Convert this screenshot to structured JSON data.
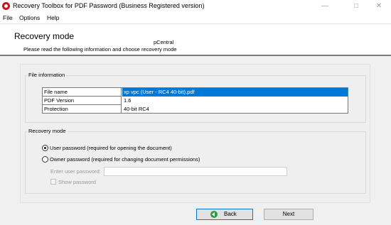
{
  "window": {
    "title": "Recovery Toolbox for PDF Password (Business Registered version)",
    "minimize_glyph": "—",
    "maximize_glyph": "□",
    "close_glyph": "✕"
  },
  "menu": {
    "items": [
      "File",
      "Options",
      "Help"
    ]
  },
  "header": {
    "title": "Recovery mode",
    "brand": "pCentral",
    "subtitle": "Please read the following information and choose recovery mode"
  },
  "file_information": {
    "group_title": "File information",
    "rows": [
      {
        "key": "File name",
        "value": "xp vpc (User - RC4 40-bit).pdf"
      },
      {
        "key": "PDF Version",
        "value": "1.6"
      },
      {
        "key": "Protection",
        "value": "40-bit RC4"
      }
    ]
  },
  "recovery_mode": {
    "group_title": "Recovery mode",
    "options": [
      {
        "label": "User password (required for opening the document)",
        "checked": true
      },
      {
        "label": "Owner password (required for changing document permissions)",
        "checked": false
      }
    ],
    "password_label": "Enter user password:",
    "password_value": "",
    "show_password_label": "Show password",
    "show_password_checked": false
  },
  "buttons": {
    "back": "Back",
    "next": "Next"
  },
  "icons": {
    "app": "pdf-lock-icon",
    "back": "back-arrow-icon"
  },
  "colors": {
    "selection": "#0078d7",
    "back_icon": "#2e9c43",
    "app_icon": "#c8161d"
  }
}
